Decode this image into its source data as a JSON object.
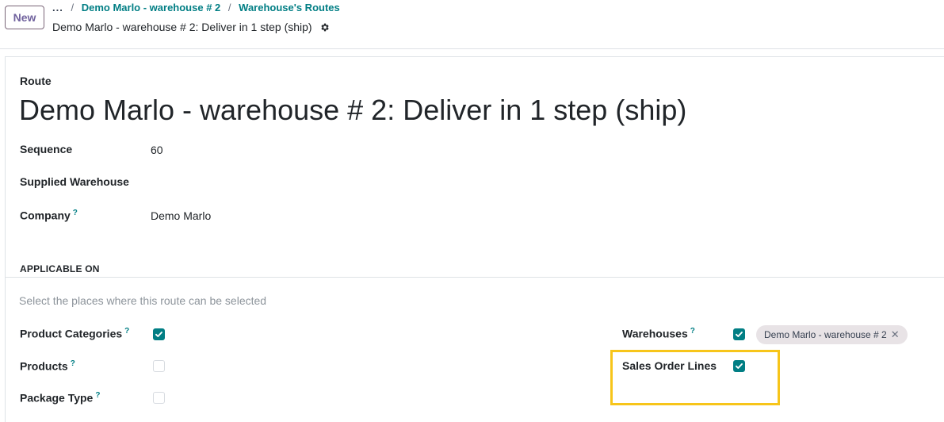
{
  "control_panel": {
    "new_label": "New",
    "breadcrumb_more": "...",
    "breadcrumb_sep": "/",
    "breadcrumbs": [
      "Demo Marlo - warehouse # 2",
      "Warehouse's Routes"
    ],
    "record_title": "Demo Marlo - warehouse # 2: Deliver in 1 step (ship)"
  },
  "form": {
    "route_label": "Route",
    "route_name": "Demo Marlo - warehouse # 2: Deliver in 1 step (ship)",
    "fields": {
      "sequence_label": "Sequence",
      "sequence_value": "60",
      "supplied_warehouse_label": "Supplied Warehouse",
      "supplied_warehouse_value": "",
      "company_label": "Company",
      "company_value": "Demo Marlo",
      "help_mark": "?"
    },
    "applicable_on": {
      "section_title": "APPLICABLE ON",
      "hint": "Select the places where this route can be selected",
      "product_categories_label": "Product Categories",
      "product_categories_checked": true,
      "products_label": "Products",
      "products_checked": false,
      "package_type_label": "Package Type",
      "package_type_checked": false,
      "warehouses_label": "Warehouses",
      "warehouses_checked": true,
      "warehouse_tag": "Demo Marlo - warehouse # 2",
      "tag_remove": "✕",
      "sales_order_lines_label": "Sales Order Lines",
      "sales_order_lines_checked": true
    }
  },
  "colors": {
    "accent": "#017e84",
    "highlight": "#f7c51a"
  }
}
